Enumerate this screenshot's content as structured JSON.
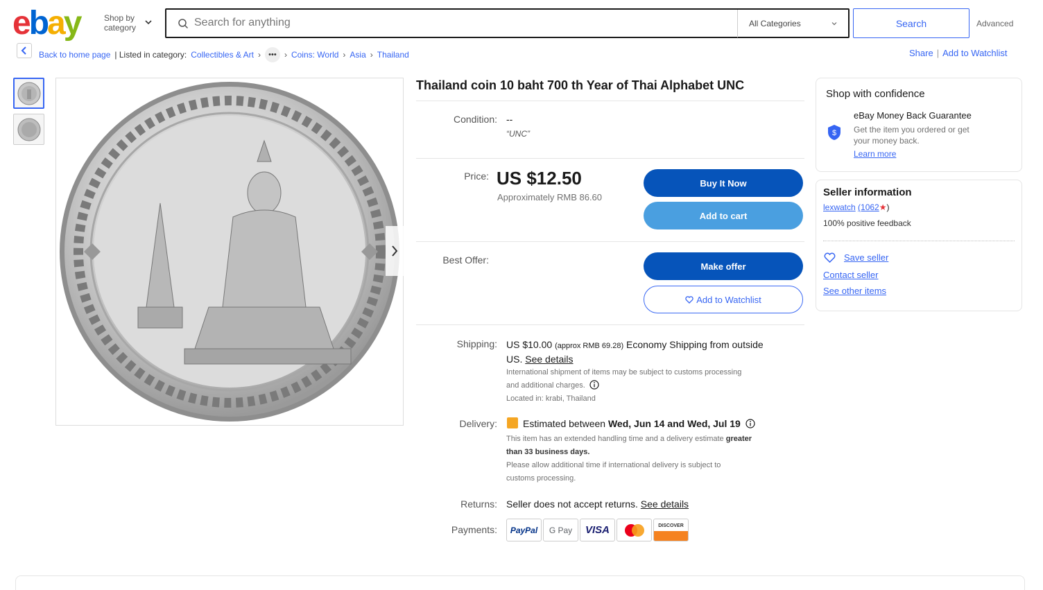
{
  "header": {
    "logo": {
      "e": "e",
      "b": "b",
      "a": "a",
      "y": "y"
    },
    "shop_by_line1": "Shop by",
    "shop_by_line2": "category",
    "search_placeholder": "Search for anything",
    "category_select": "All Categories",
    "search_button": "Search",
    "advanced": "Advanced"
  },
  "breadcrumb": {
    "back": "Back to home page",
    "listed_in": "| Listed in category:",
    "items": [
      "Collectibles & Art",
      "Coins: World",
      "Asia",
      "Thailand"
    ],
    "more": "•••",
    "share": "Share",
    "watchlist": "Add to Watchlist"
  },
  "item": {
    "title": "Thailand coin 10 baht 700 th Year of Thai Alphabet UNC",
    "condition_label": "Condition:",
    "condition_value": "--",
    "condition_note": "“UNC”",
    "price_label": "Price:",
    "price": "US $12.50",
    "price_approx": "Approximately RMB 86.60",
    "buy_now": "Buy It Now",
    "add_to_cart": "Add to cart",
    "best_offer_label": "Best Offer:",
    "make_offer": "Make offer",
    "add_to_watchlist": "Add to Watchlist",
    "shipping_label": "Shipping:",
    "shipping_price": "US $10.00",
    "shipping_approx": "(approx RMB 69.28)",
    "shipping_method": "Economy Shipping from outside",
    "shipping_method2": "US.",
    "see_details": "See details",
    "shipping_note1": "International shipment of items may be subject to customs processing",
    "shipping_note2": "and additional charges.",
    "located": "Located in: krabi, Thailand",
    "delivery_label": "Delivery:",
    "delivery_prefix": "Estimated between",
    "delivery_dates": "Wed, Jun 14 and Wed, Jul 19",
    "delivery_note1": "This item has an extended handling time and a delivery estimate",
    "delivery_note1_bold": "greater",
    "delivery_note2_bold": "than 33 business days.",
    "delivery_note3": "Please allow additional time if international delivery is subject to",
    "delivery_note4": "customs processing.",
    "returns_label": "Returns:",
    "returns_value": "Seller does not accept returns.",
    "returns_details": "See details",
    "payments_label": "Payments:",
    "payments": [
      "PayPal",
      "G Pay",
      "VISA",
      "Mastercard",
      "DISCOVER"
    ]
  },
  "confidence": {
    "title": "Shop with confidence",
    "guarantee_title": "eBay Money Back Guarantee",
    "guarantee_text1": "Get the item you ordered or get",
    "guarantee_text2": "your money back.",
    "learn_more": "Learn more"
  },
  "seller": {
    "title": "Seller information",
    "name": "lexwatch",
    "score": "(1062",
    "star": "★",
    "score_close": ")",
    "feedback": "100% positive feedback",
    "save_seller": "Save seller",
    "contact_seller": "Contact seller",
    "see_other_items": "See other items"
  },
  "colors": {
    "accent": "#3665f3",
    "primary_button": "#0654ba",
    "secondary_button": "#4a9fe0"
  }
}
